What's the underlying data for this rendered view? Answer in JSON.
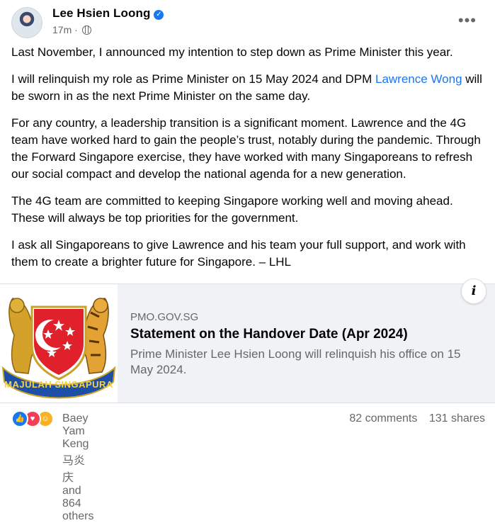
{
  "post": {
    "author": "Lee Hsien Loong",
    "time": "17m",
    "paragraphs": {
      "p1": "Last November, I announced my intention to step down as Prime Minister this year.",
      "p2_before": "I will relinquish my role as Prime Minister on 15 May 2024 and DPM ",
      "p2_link": "Lawrence Wong",
      "p2_after": " will be sworn in as the next Prime Minister on the same day.",
      "p3": "For any country, a leadership transition is a significant moment. Lawrence and the 4G team have worked hard to gain the people’s trust, notably during the pandemic. Through the Forward Singapore exercise, they have worked with many Singaporeans to refresh our social compact and develop the national agenda for a new generation.",
      "p4": "The 4G team are committed to keeping Singapore working well and moving ahead. These will always be top priorities for the government.",
      "p5": "I ask all Singaporeans to give Lawrence and his team your full support, and work with them to create a brighter future for Singapore. – LHL"
    }
  },
  "card": {
    "image_text": "MAJULAH SINGAPURA",
    "domain": "PMO.GOV.SG",
    "title": "Statement on the Handover Date (Apr 2024)",
    "description": "Prime Minister Lee Hsien Loong will relinquish his office on 15 May 2024.",
    "info_label": "i"
  },
  "footer": {
    "reactions_text": "Baey Yam Keng 马炎庆 and 864 others",
    "comments": "82 comments",
    "shares": "131 shares"
  },
  "icons": {
    "more": "more-options-icon",
    "verified": "verified-badge-icon",
    "globe": "globe-icon",
    "like": "like-reaction-icon",
    "love": "love-reaction-icon",
    "care": "care-reaction-icon"
  },
  "colors": {
    "link": "#1877f2",
    "muted": "#65676b",
    "card_bg": "#f0f2f5"
  }
}
